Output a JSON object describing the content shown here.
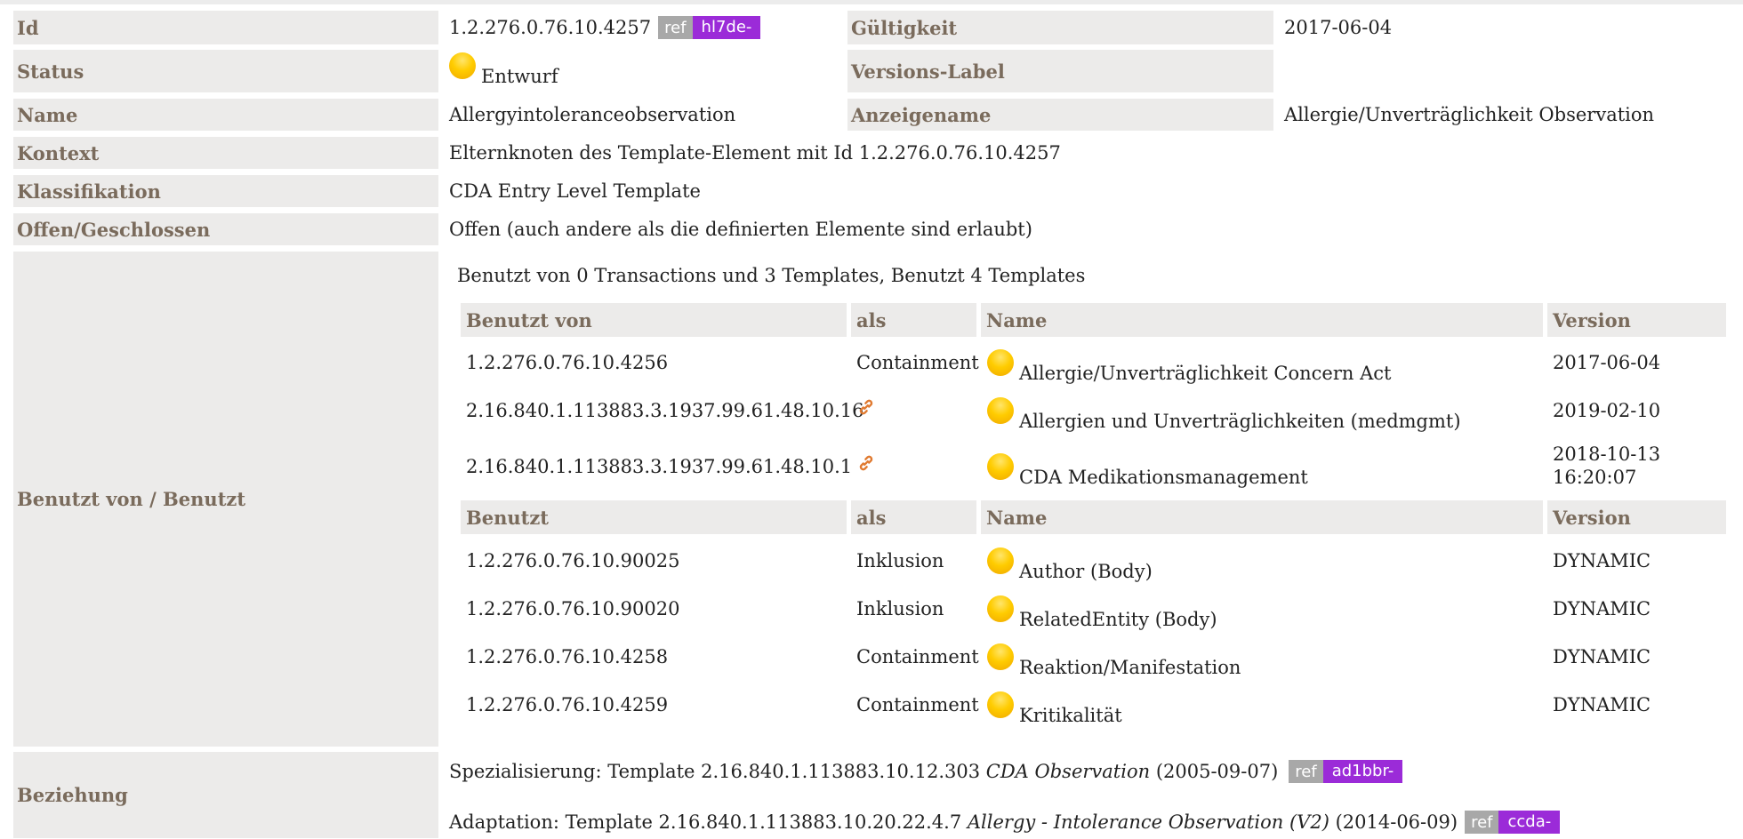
{
  "rows": {
    "id": {
      "label": "Id",
      "value": "1.2.276.0.76.10.4257",
      "ref": "ref",
      "prefix": "hl7de-",
      "label2": "Gültigkeit",
      "value2": "2017-06-04"
    },
    "status": {
      "label": "Status",
      "value": "Entwurf",
      "label2": "Versions-Label",
      "value2": ""
    },
    "name": {
      "label": "Name",
      "value": "Allergyintoleranceobservation",
      "label2": "Anzeigename",
      "value2": "Allergie/Unverträglichkeit Observation"
    },
    "kontext": {
      "label": "Kontext",
      "value": "Elternknoten des Template-Element mit Id 1.2.276.0.76.10.4257"
    },
    "klass": {
      "label": "Klassifikation",
      "value": "CDA Entry Level Template"
    },
    "offen": {
      "label": "Offen/Geschlossen",
      "value": "Offen (auch andere als die definierten Elemente sind erlaubt)"
    },
    "benutzt": {
      "label": "Benutzt von / Benutzt",
      "summary": "Benutzt von 0 Transactions und 3 Templates, Benutzt 4 Templates"
    },
    "beziehung": {
      "label": "Beziehung"
    }
  },
  "used_by": {
    "headers": [
      "Benutzt von",
      "als",
      "Name",
      "Version"
    ],
    "rows": [
      {
        "id": "1.2.276.0.76.10.4256",
        "as": "Containment",
        "link": false,
        "name": "Allergie/Unverträglichkeit Concern Act",
        "version": "2017-06-04",
        "version2": ""
      },
      {
        "id": "2.16.840.1.113883.3.1937.99.61.48.10.16",
        "as": "",
        "link": true,
        "name": "Allergien und Unverträglichkeiten (medmgmt)",
        "version": "2019-02-10",
        "version2": ""
      },
      {
        "id": "2.16.840.1.113883.3.1937.99.61.48.10.1",
        "as": "",
        "link": true,
        "name": "CDA Medikationsmanagement",
        "version": "2018-10-13",
        "version2": "16:20:07"
      }
    ]
  },
  "uses": {
    "headers": [
      "Benutzt",
      "als",
      "Name",
      "Version"
    ],
    "rows": [
      {
        "id": "1.2.276.0.76.10.90025",
        "as": "Inklusion",
        "name": "Author (Body)",
        "version": "DYNAMIC"
      },
      {
        "id": "1.2.276.0.76.10.90020",
        "as": "Inklusion",
        "name": "RelatedEntity (Body)",
        "version": "DYNAMIC"
      },
      {
        "id": "1.2.276.0.76.10.4258",
        "as": "Containment",
        "name": "Reaktion/Manifestation",
        "version": "DYNAMIC"
      },
      {
        "id": "1.2.276.0.76.10.4259",
        "as": "Containment",
        "name": "Kritikalität",
        "version": "DYNAMIC"
      }
    ]
  },
  "relations": [
    {
      "kind": "Spezialisierung: Template 2.16.840.1.113883.10.12.303",
      "title": "CDA Observation",
      "date": "(2005-09-07)",
      "ref": "ref",
      "prefix": "ad1bbr-"
    },
    {
      "kind": "Adaptation: Template 2.16.840.1.113883.10.20.22.4.7",
      "title": "Allergy - Intolerance Observation (V2)",
      "date": "(2014-06-09)",
      "ref": "ref",
      "prefix": "ccda-"
    }
  ],
  "icons": {
    "status": "yellow-draft-ball-icon",
    "link": "chain-link-icon"
  },
  "colors": {
    "label_bg": "#ecebea",
    "label_text": "#7a6b5c",
    "prefix_bg": "#9b2bd8",
    "ref_bg": "#a8a8a8",
    "status_ball": "#ffcc00"
  }
}
